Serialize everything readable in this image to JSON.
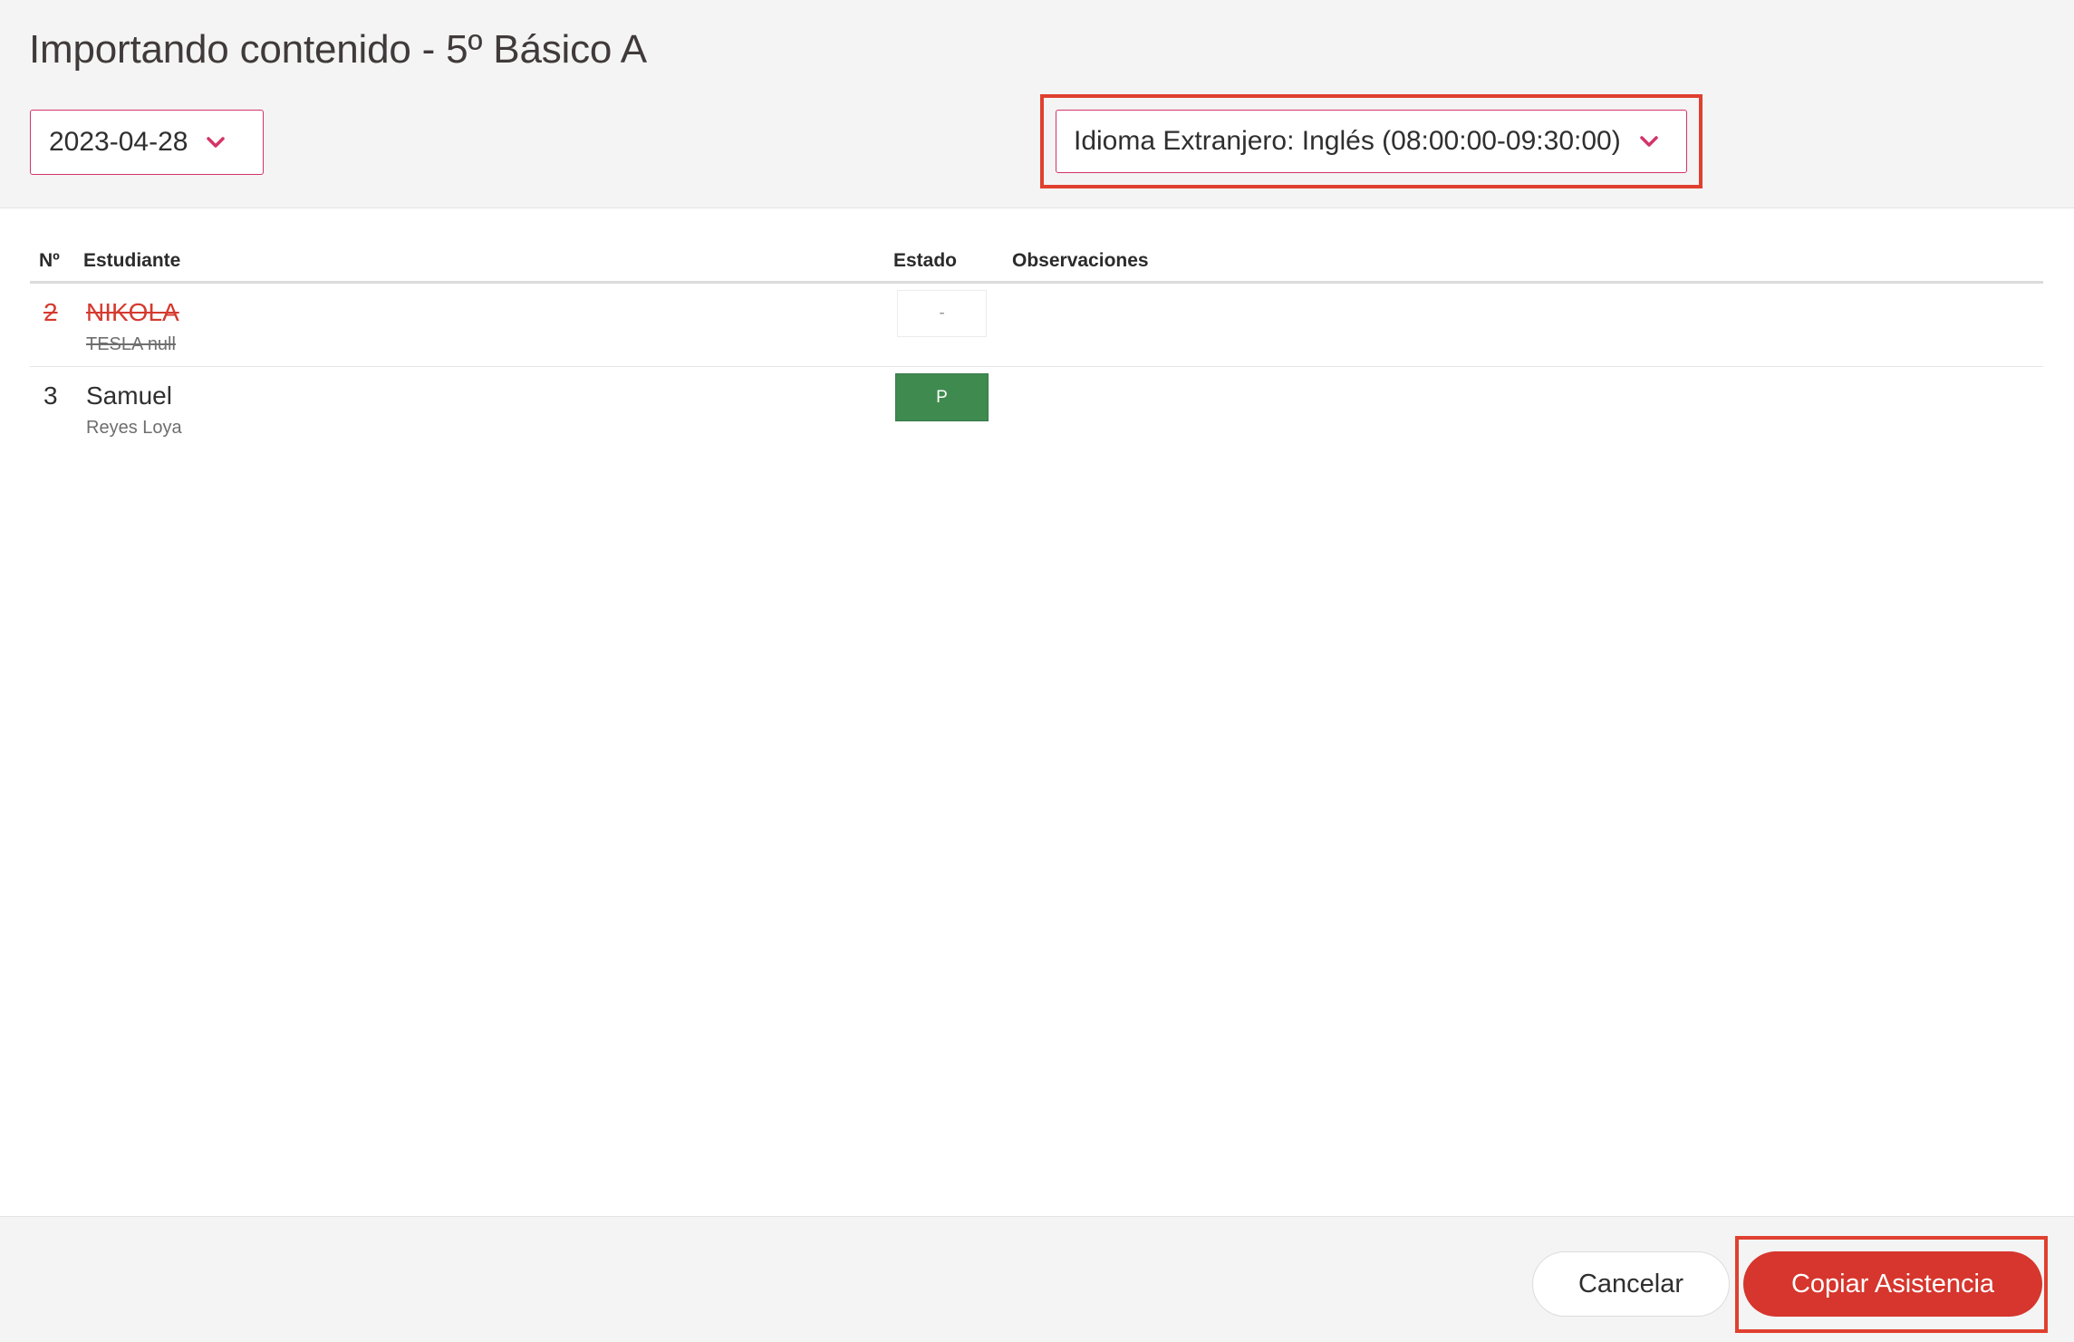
{
  "header": {
    "title": "Importando contenido - 5º Básico A",
    "date_select": {
      "value": "2023-04-28",
      "icon": "chevron-down-icon"
    },
    "class_select": {
      "value": "Idioma Extranjero: Inglés (08:00:00-09:30:00)",
      "icon": "chevron-down-icon",
      "highlighted": true
    }
  },
  "table": {
    "columns": {
      "num": "Nº",
      "student": "Estudiante",
      "estado": "Estado",
      "observaciones": "Observaciones"
    },
    "rows": [
      {
        "num": "2",
        "first_name": "NIKOLA",
        "last_name": "TESLA null",
        "status": "-",
        "withdrawn": true,
        "observaciones": ""
      },
      {
        "num": "3",
        "first_name": "Samuel",
        "last_name": "Reyes Loya",
        "status": "P",
        "withdrawn": false,
        "observaciones": ""
      }
    ]
  },
  "footer": {
    "cancel_label": "Cancelar",
    "copy_label": "Copiar Asistencia"
  },
  "colors": {
    "accent": "#d43468",
    "primary_button": "#d6362d",
    "present_status": "#3f8a4e",
    "highlight_box": "#e0402f",
    "withdrawn_text": "#d53a2f"
  }
}
